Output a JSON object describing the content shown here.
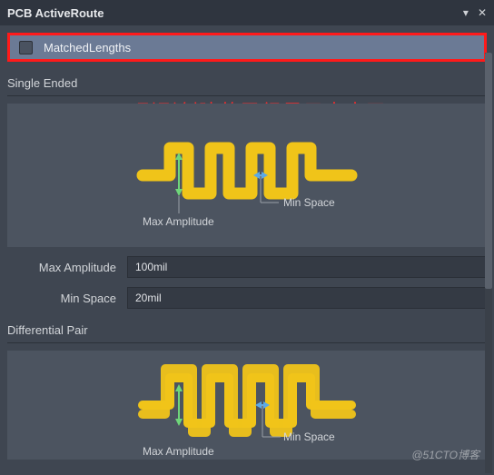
{
  "titlebar": {
    "title": "PCB ActiveRoute"
  },
  "highlight": {
    "label": "MatchedLengths"
  },
  "annotation": "刚刚创建的已经显示出来了",
  "section1": {
    "heading": "Single Ended",
    "diagram": {
      "max_amp_label": "Max Amplitude",
      "min_space_label": "Min Space"
    },
    "fields": {
      "max_amp_label": "Max Amplitude",
      "max_amp_value": "100mil",
      "min_space_label": "Min Space",
      "min_space_value": "20mil"
    }
  },
  "section2": {
    "heading": "Differential Pair",
    "diagram": {
      "max_amp_label": "Max Amplitude",
      "min_space_label": "Min Space"
    }
  },
  "watermark": "@51CTO博客"
}
